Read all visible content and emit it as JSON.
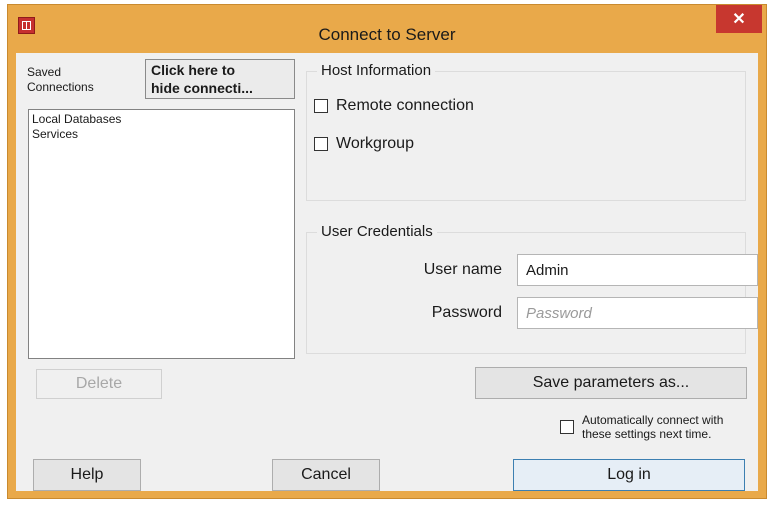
{
  "window": {
    "title": "Connect to Server",
    "close_label": "✕"
  },
  "saved": {
    "label_line1": "Saved",
    "label_line2": "Connections",
    "hide_button_line1": "Click here to",
    "hide_button_line2": "hide connecti...",
    "items": [
      "Local Databases",
      "Services"
    ],
    "delete_label": "Delete"
  },
  "host": {
    "group_title": "Host Information",
    "remote_label": "Remote connection",
    "remote_checked": false,
    "workgroup_label": "Workgroup",
    "workgroup_checked": false
  },
  "credentials": {
    "group_title": "User Credentials",
    "username_label": "User name",
    "username_value": "Admin",
    "password_label": "Password",
    "password_placeholder": "Password"
  },
  "save_params_label": "Save parameters as...",
  "auto_connect": {
    "line1": "Automatically connect with",
    "line2": "these settings next time.",
    "checked": false
  },
  "footer": {
    "help_label": "Help",
    "cancel_label": "Cancel",
    "login_label": "Log in"
  },
  "colors": {
    "frame": "#e9a94a",
    "close": "#c7372f",
    "client": "#f0f0f0"
  }
}
